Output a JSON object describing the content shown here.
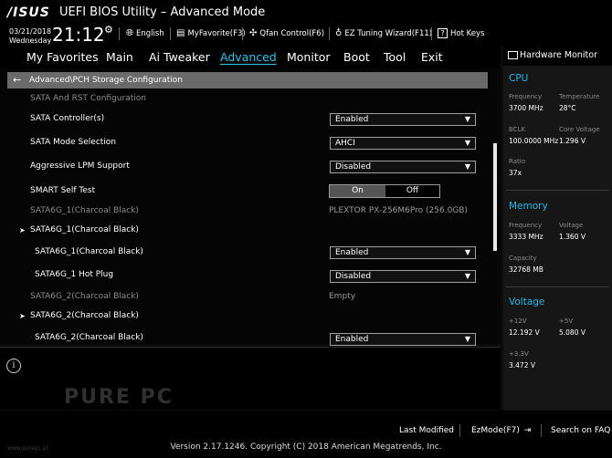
{
  "header": {
    "logo": "/ISUS",
    "title": "UEFI BIOS Utility – Advanced Mode",
    "date": "03/21/2018",
    "weekday": "Wednesday",
    "time": "21:12",
    "tools": {
      "language": "English",
      "myfavorite": "MyFavorite(F3)",
      "qfan": "Qfan Control(F6)",
      "ez_tuning": "EZ Tuning Wizard(F11)",
      "hotkeys": "Hot Keys"
    }
  },
  "menu": {
    "items": [
      "My Favorites",
      "Main",
      "Ai Tweaker",
      "Advanced",
      "Monitor",
      "Boot",
      "Tool",
      "Exit"
    ],
    "active": "Advanced"
  },
  "main": {
    "breadcrumb": "Advanced\\PCH Storage Configuration",
    "section_title": "SATA And RST Configuration",
    "rows": [
      {
        "label": "SATA Controller(s)",
        "value": "Enabled"
      },
      {
        "label": "SATA Mode Selection",
        "value": "AHCI"
      },
      {
        "label": "Aggressive LPM Support",
        "value": "Disabled"
      },
      {
        "label": "SMART Self Test",
        "on": "On",
        "off": "Off"
      },
      {
        "label": "SATA6G_1(Charcoal Black)",
        "value": "PLEXTOR PX-256M6Pro (256.0GB)"
      },
      {
        "label": "SATA6G_1(Charcoal Black)"
      },
      {
        "label": "SATA6G_1(Charcoal Black)",
        "value": "Enabled"
      },
      {
        "label": "SATA6G_1 Hot Plug",
        "value": "Disabled"
      },
      {
        "label": "SATA6G_2(Charcoal Black)",
        "value": "Empty"
      },
      {
        "label": "SATA6G_2(Charcoal Black)"
      },
      {
        "label": "SATA6G_2(Charcoal Black)",
        "value": "Enabled"
      }
    ]
  },
  "hw_monitor": {
    "title": "Hardware Monitor",
    "cpu": {
      "heading": "CPU",
      "frequency_label": "Frequency",
      "frequency": "3700 MHz",
      "temperature_label": "Temperature",
      "temperature": "28°C",
      "bclk_label": "BCLK",
      "bclk": "100.0000 MHz",
      "core_voltage_label": "Core Voltage",
      "core_voltage": "1.296 V",
      "ratio_label": "Ratio",
      "ratio": "37x"
    },
    "memory": {
      "heading": "Memory",
      "frequency_label": "Frequency",
      "frequency": "3333 MHz",
      "voltage_label": "Voltage",
      "voltage": "1.360 V",
      "capacity_label": "Capacity",
      "capacity": "32768 MB"
    },
    "voltage": {
      "heading": "Voltage",
      "v12_label": "+12V",
      "v12": "12.192 V",
      "v5_label": "+5V",
      "v5": "5.080 V",
      "v33_label": "+3.3V",
      "v33": "3.472 V"
    }
  },
  "footer": {
    "last_modified": "Last Modified",
    "ezmode": "EzMode(F7)",
    "search": "Search on FAQ",
    "version": "Version 2.17.1246. Copyright (C) 2018 American Megatrends, Inc.",
    "watermark": "PURE PC",
    "watermark_url": "www.purepc.pl"
  },
  "colors": {
    "accent": "#31c4e8",
    "hw_accent": "#2fb8e8",
    "breadcrumb_bg": "#6a6a6a"
  }
}
